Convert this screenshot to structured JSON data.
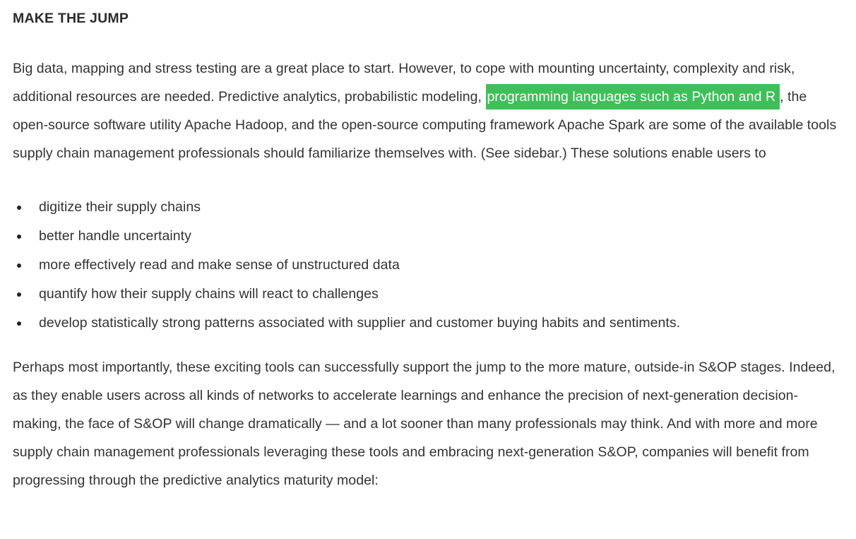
{
  "section": {
    "heading": "MAKE THE JUMP"
  },
  "intro": {
    "before_highlight": "Big data, mapping and stress testing are a great place to start. However, to cope with mounting uncertainty, complexity and risk, additional resources are needed. Predictive analytics, probabilistic modeling, ",
    "highlight": "programming languages such as Python and R",
    "after_highlight": ", the open-source software utility Apache Hadoop, and the open-source computing framework Apache Spark are some of the available tools supply chain management professionals should familiarize themselves with. (See sidebar.) These solutions enable users to",
    "highlight_color": "#3fbf5a"
  },
  "bullets": [
    "digitize their supply chains",
    "better handle uncertainty",
    "more effectively read and make sense of unstructured data",
    "quantify how their supply chains will react to challenges",
    "develop statistically strong patterns associated with supplier and customer buying habits and sentiments."
  ],
  "closing": {
    "text": "Perhaps most importantly, these exciting tools can successfully support the jump to the more mature, outside-in S&OP stages. Indeed, as they enable users across all kinds of networks to accelerate learnings and enhance the precision of next-generation decision-making, the face of S&OP will change dramatically — and a lot sooner than many professionals may think. And with more and more supply chain management professionals leveraging these tools and embracing next-generation S&OP, companies will benefit from progressing through the predictive analytics maturity model:"
  }
}
